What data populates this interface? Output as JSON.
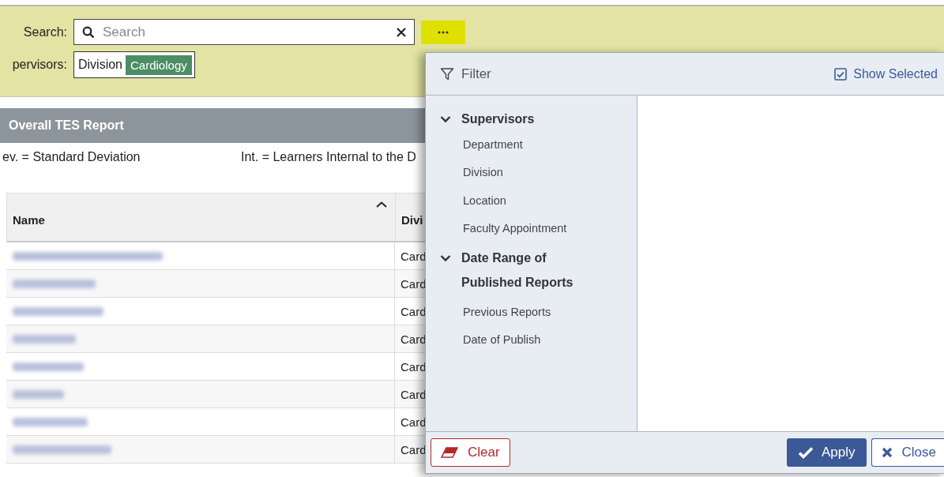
{
  "toolbar": {
    "search_label": "Search:",
    "search_placeholder": "Search",
    "supervisors_label": "pervisors:",
    "chip": {
      "label": "Division",
      "value": "Cardiology"
    }
  },
  "report": {
    "title": "Overall TES Report",
    "legend": [
      "ev. = Standard Deviation",
      "Int. = Learners Internal to the D"
    ]
  },
  "table": {
    "columns": [
      {
        "label": "Name",
        "sorted": true
      },
      {
        "label": "Divi",
        "sorted": false
      }
    ],
    "rows": [
      {
        "division": "Card"
      },
      {
        "division": "Card"
      },
      {
        "division": "Card"
      },
      {
        "division": "Card"
      },
      {
        "division": "Card"
      },
      {
        "division": "Card"
      },
      {
        "division": "Card"
      },
      {
        "division": "Card"
      }
    ]
  },
  "filter_panel": {
    "title": "Filter",
    "show_selected": {
      "label": "Show Selected",
      "checked": true
    },
    "groups": [
      {
        "label": "Supervisors",
        "expanded": true,
        "children": [
          {
            "label": "Department"
          },
          {
            "label": "Division"
          },
          {
            "label": "Location"
          },
          {
            "label": "Faculty Appointment"
          }
        ]
      },
      {
        "label": "Date Range of Published Reports",
        "expanded": true,
        "children": [
          {
            "label": "Previous Reports"
          },
          {
            "label": "Date of Publish"
          }
        ]
      }
    ],
    "buttons": {
      "clear": "Clear",
      "apply": "Apply",
      "close": "Close"
    }
  }
}
